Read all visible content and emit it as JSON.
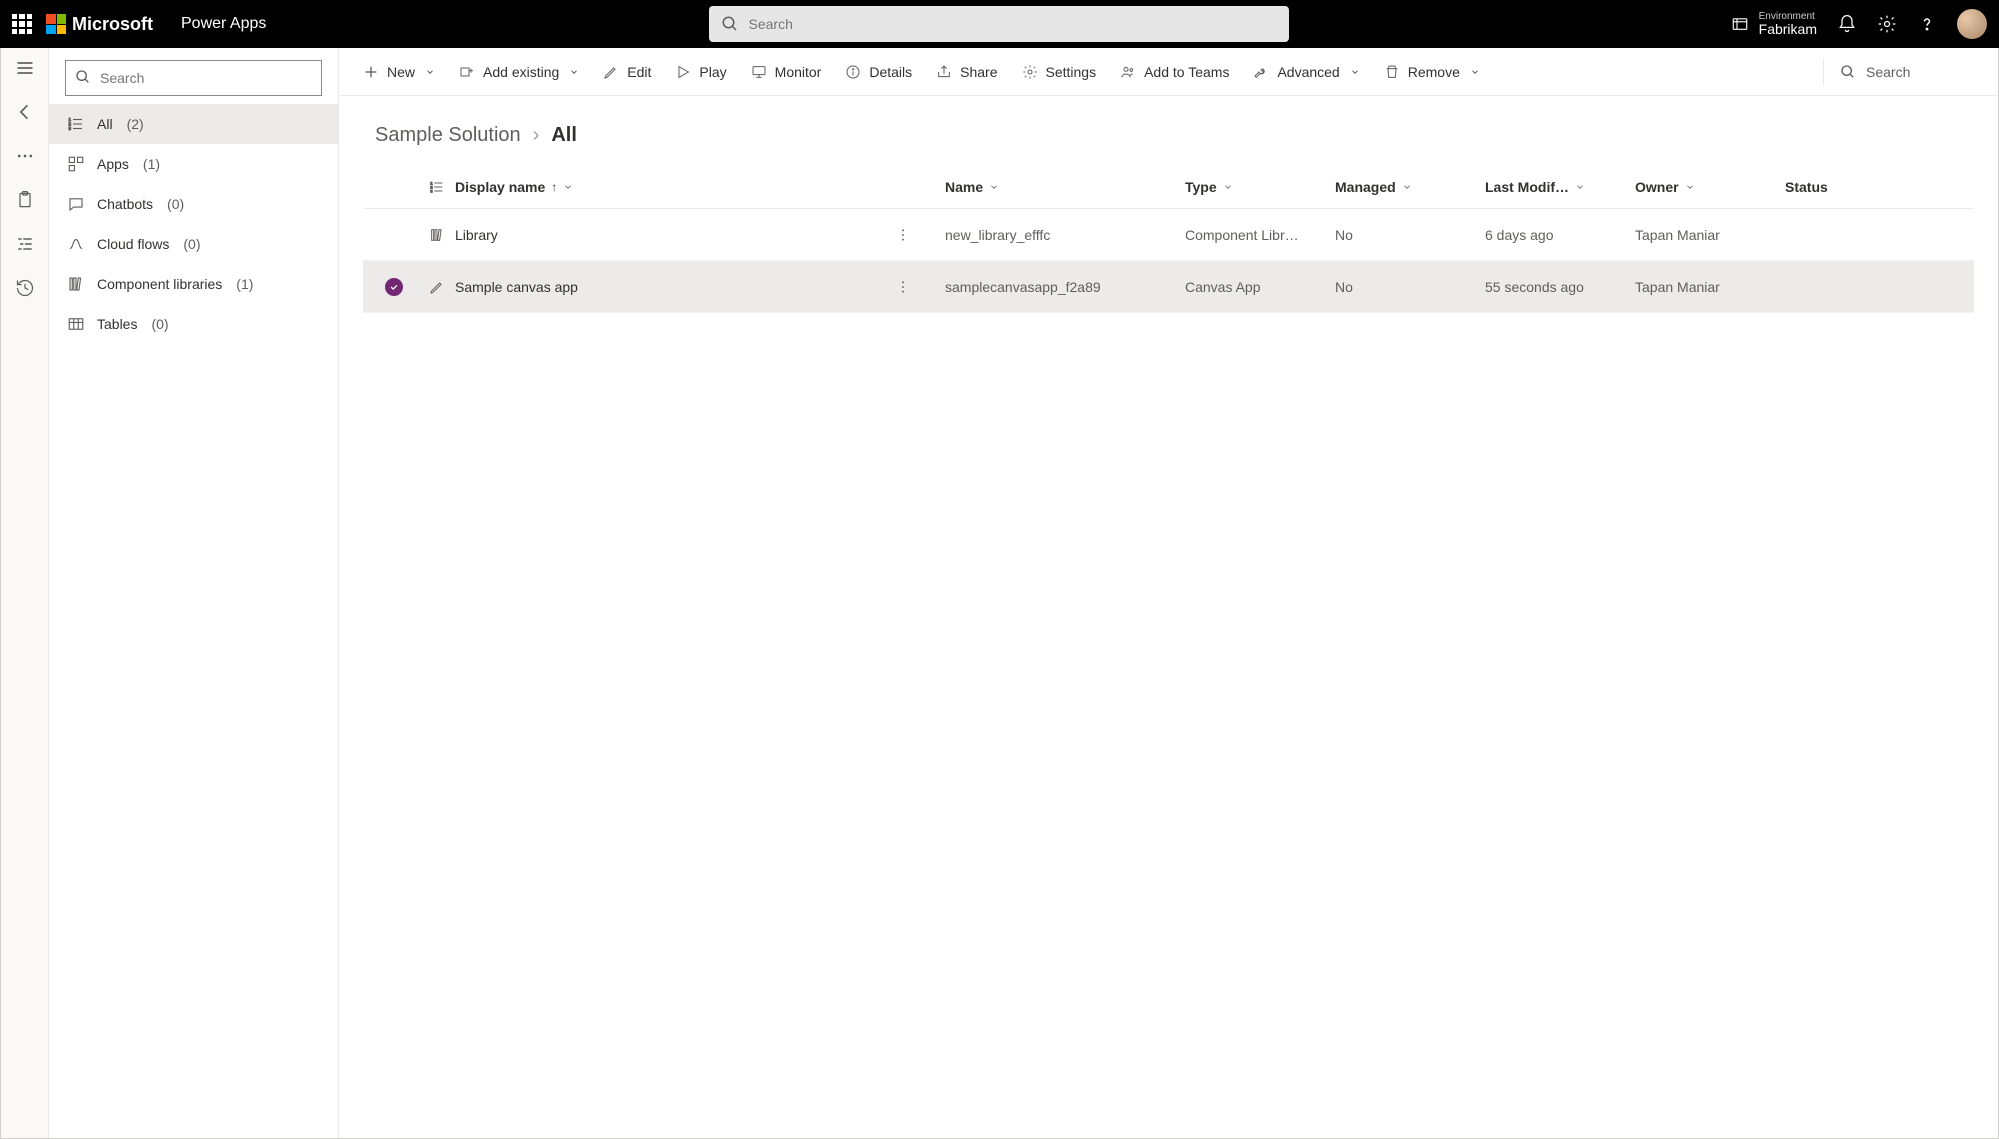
{
  "header": {
    "brand": "Microsoft",
    "app_name": "Power Apps",
    "search_placeholder": "Search",
    "env_label": "Environment",
    "env_name": "Fabrikam"
  },
  "nav": {
    "search_placeholder": "Search",
    "items": [
      {
        "label": "All",
        "count": "(2)",
        "selected": true,
        "icon": "list"
      },
      {
        "label": "Apps",
        "count": "(1)",
        "selected": false,
        "icon": "app"
      },
      {
        "label": "Chatbots",
        "count": "(0)",
        "selected": false,
        "icon": "chat"
      },
      {
        "label": "Cloud flows",
        "count": "(0)",
        "selected": false,
        "icon": "flow"
      },
      {
        "label": "Component libraries",
        "count": "(1)",
        "selected": false,
        "icon": "library"
      },
      {
        "label": "Tables",
        "count": "(0)",
        "selected": false,
        "icon": "table"
      }
    ]
  },
  "commands": {
    "new": "New",
    "add_existing": "Add existing",
    "edit": "Edit",
    "play": "Play",
    "monitor": "Monitor",
    "details": "Details",
    "share": "Share",
    "settings": "Settings",
    "add_to_teams": "Add to Teams",
    "advanced": "Advanced",
    "remove": "Remove",
    "search_placeholder": "Search"
  },
  "breadcrumb": {
    "solution": "Sample Solution",
    "current": "All"
  },
  "table": {
    "columns": {
      "display_name": "Display name",
      "name": "Name",
      "type": "Type",
      "managed": "Managed",
      "last_modified": "Last Modif…",
      "owner": "Owner",
      "status": "Status"
    },
    "rows": [
      {
        "selected": false,
        "icon": "library",
        "display": "Library",
        "name": "new_library_efffc",
        "type": "Component Libr…",
        "managed": "No",
        "modified": "6 days ago",
        "owner": "Tapan Maniar",
        "status": ""
      },
      {
        "selected": true,
        "icon": "edit",
        "display": "Sample canvas app",
        "name": "samplecanvasapp_f2a89",
        "type": "Canvas App",
        "managed": "No",
        "modified": "55 seconds ago",
        "owner": "Tapan Maniar",
        "status": ""
      }
    ]
  }
}
